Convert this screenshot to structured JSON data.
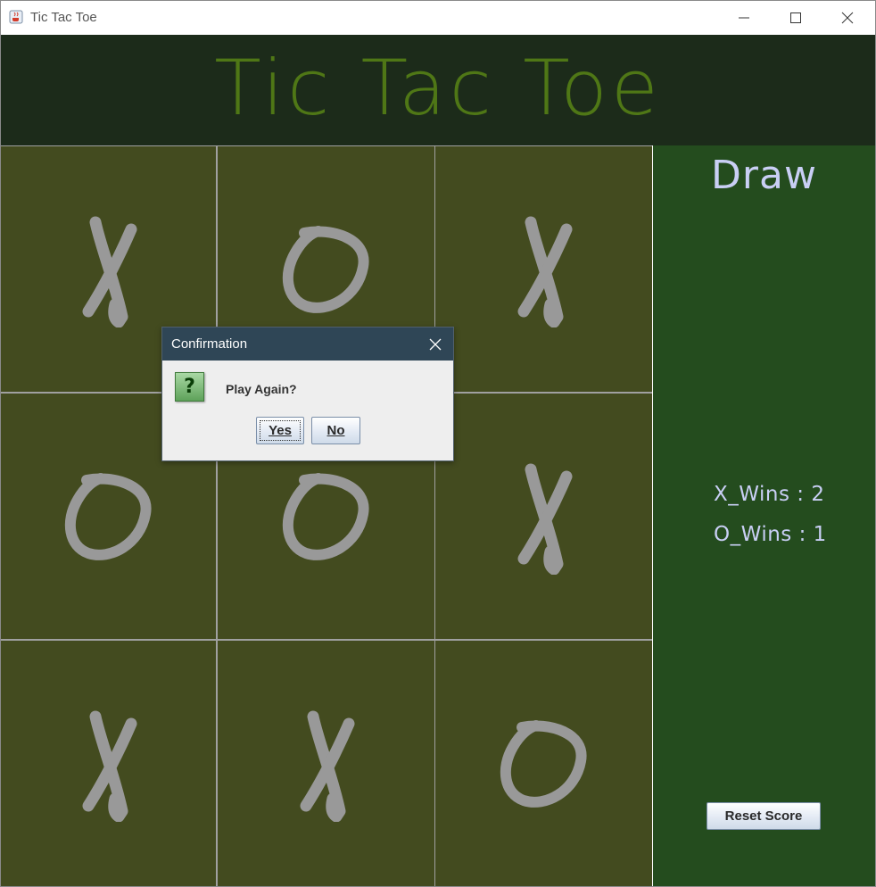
{
  "window": {
    "title": "Tic Tac Toe",
    "app_icon": "java-cup-icon",
    "controls": [
      "minimize-icon",
      "maximize-icon",
      "close-icon"
    ]
  },
  "header": {
    "title": "Tic Tac Toe"
  },
  "board": {
    "cells": [
      "X",
      "O",
      "X",
      "O",
      "O",
      "X",
      "X",
      "X",
      "O"
    ]
  },
  "side_panel": {
    "status": "Draw",
    "x_wins": "X_Wins : 2",
    "o_wins": "O_Wins : 1",
    "reset_label": "Reset Score"
  },
  "dialog": {
    "title": "Confirmation",
    "message": "Play Again?",
    "icon": "question-icon",
    "yes_label": "Yes",
    "no_label": "No"
  },
  "colors": {
    "header_bg": "#1c2b1a",
    "header_text": "#4f7716",
    "cell_bg": "#434b1f",
    "mark_color": "#999999",
    "side_bg": "#244c1e",
    "side_text": "#c9cff5",
    "dialog_title_bg": "#2f4656"
  }
}
